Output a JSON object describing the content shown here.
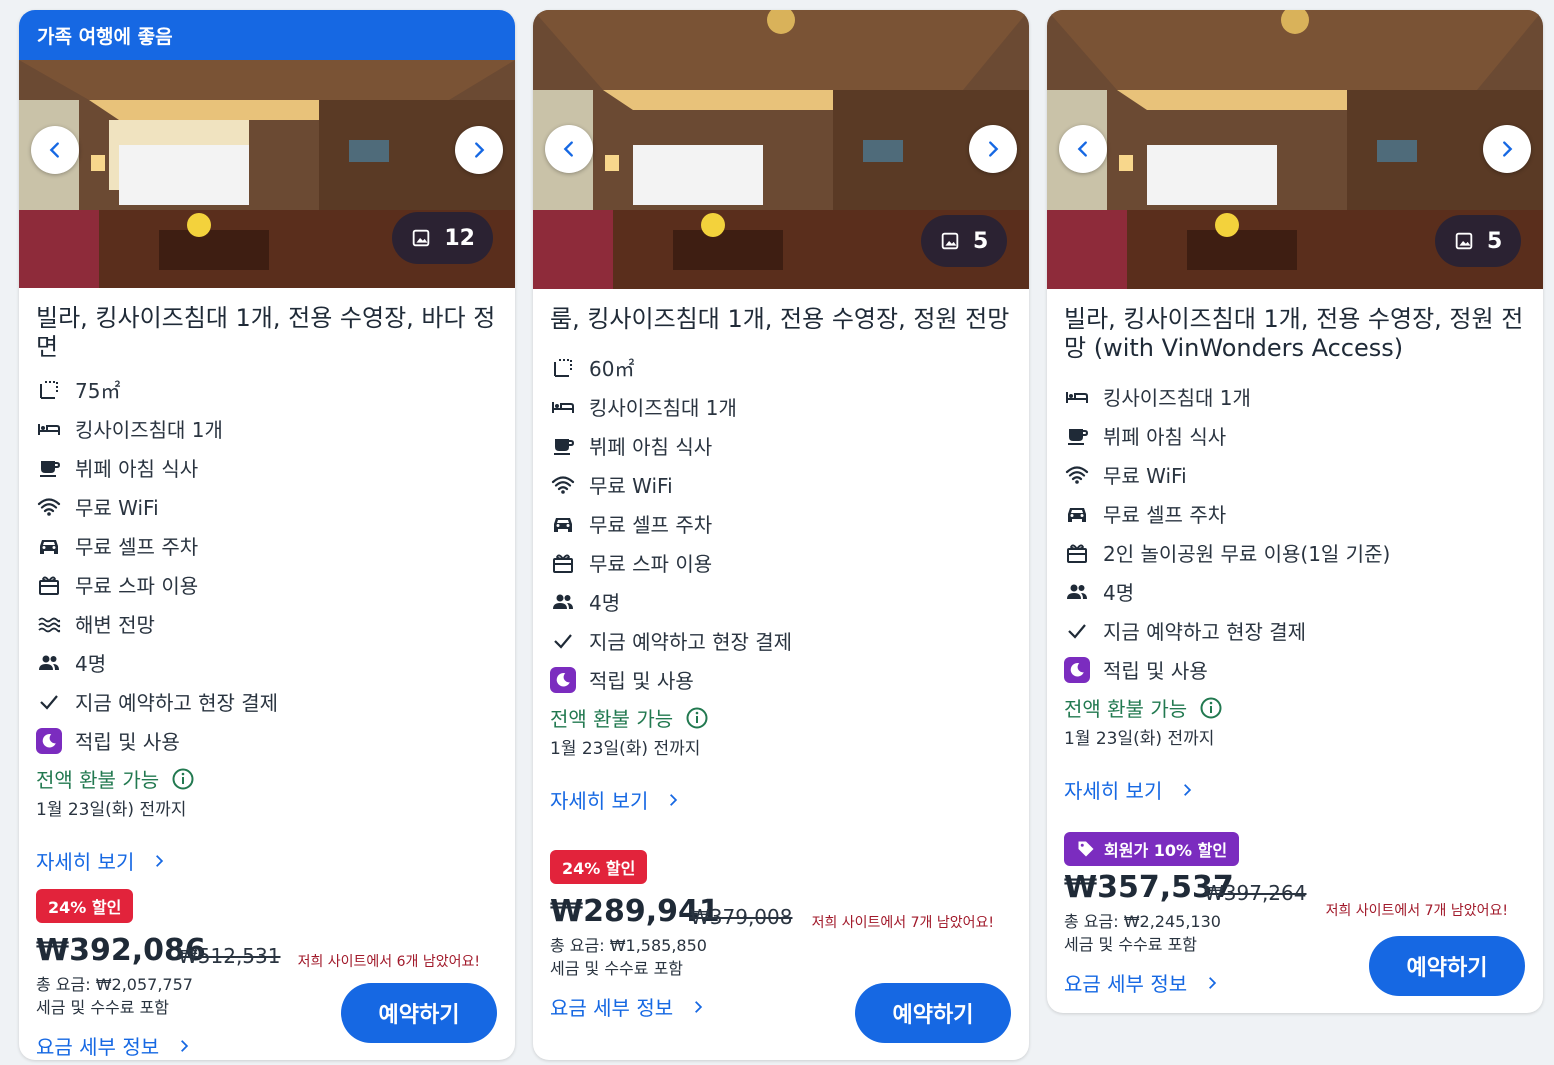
{
  "cards": [
    {
      "banner": "가족 여행에 좋음",
      "photo_count": "12",
      "title": "빌라, 킹사이즈침대 1개, 전용 수영장, 바다 정면",
      "amenities": [
        {
          "icon": "area-icon",
          "label": "75㎡"
        },
        {
          "icon": "bed-icon",
          "label": "킹사이즈침대 1개"
        },
        {
          "icon": "coffee-icon",
          "label": "뷔페 아침 식사"
        },
        {
          "icon": "wifi-icon",
          "label": "무료 WiFi"
        },
        {
          "icon": "car-icon",
          "label": "무료 셀프 주차"
        },
        {
          "icon": "spa-icon",
          "label": "무료 스파 이용"
        },
        {
          "icon": "waves-icon",
          "label": "해변 전망"
        },
        {
          "icon": "people-icon",
          "label": "4명"
        },
        {
          "icon": "check-icon",
          "label": "지금 예약하고 현장 결제"
        },
        {
          "icon": "moon-icon",
          "label": "적립 및 사용"
        }
      ],
      "refund": "전액 환불 가능",
      "refund_date": "1월 23일(화) 전까지",
      "details": "자세히 보기",
      "discount": "24% 할인",
      "price": "₩392,086",
      "original_price": "₩512,531",
      "left_msg": "저희 사이트에서 6개 남았어요!",
      "total": "총 요금: ₩2,057,757",
      "tax_note": "세금 및 수수료 포함",
      "pricing_details": "요금 세부 정보",
      "reserve": "예약하기"
    },
    {
      "photo_count": "5",
      "title": "룸, 킹사이즈침대 1개, 전용 수영장, 정원 전망",
      "amenities": [
        {
          "icon": "area-icon",
          "label": "60㎡"
        },
        {
          "icon": "bed-icon",
          "label": "킹사이즈침대 1개"
        },
        {
          "icon": "coffee-icon",
          "label": "뷔페 아침 식사"
        },
        {
          "icon": "wifi-icon",
          "label": "무료 WiFi"
        },
        {
          "icon": "car-icon",
          "label": "무료 셀프 주차"
        },
        {
          "icon": "spa-icon",
          "label": "무료 스파 이용"
        },
        {
          "icon": "people-icon",
          "label": "4명"
        },
        {
          "icon": "check-icon",
          "label": "지금 예약하고 현장 결제"
        },
        {
          "icon": "moon-icon",
          "label": "적립 및 사용"
        }
      ],
      "refund": "전액 환불 가능",
      "refund_date": "1월 23일(화) 전까지",
      "details": "자세히 보기",
      "discount": "24% 할인",
      "price": "₩289,941",
      "original_price": "₩379,008",
      "left_msg": "저희 사이트에서 7개 남았어요!",
      "total": "총 요금: ₩1,585,850",
      "tax_note": "세금 및 수수료 포함",
      "pricing_details": "요금 세부 정보",
      "reserve": "예약하기"
    },
    {
      "photo_count": "5",
      "title": "빌라, 킹사이즈침대 1개, 전용 수영장, 정원 전망 (with VinWonders Access)",
      "amenities": [
        {
          "icon": "bed-icon",
          "label": "킹사이즈침대 1개"
        },
        {
          "icon": "coffee-icon",
          "label": "뷔페 아침 식사"
        },
        {
          "icon": "wifi-icon",
          "label": "무료 WiFi"
        },
        {
          "icon": "car-icon",
          "label": "무료 셀프 주차"
        },
        {
          "icon": "ticket-icon",
          "label": "2인 놀이공원 무료 이용(1일 기준)"
        },
        {
          "icon": "people-icon",
          "label": "4명"
        },
        {
          "icon": "check-icon",
          "label": "지금 예약하고 현장 결제"
        },
        {
          "icon": "moon-icon",
          "label": "적립 및 사용"
        }
      ],
      "refund": "전액 환불 가능",
      "refund_date": "1월 23일(화) 전까지",
      "details": "자세히 보기",
      "member_discount": "회원가 10% 할인",
      "price": "₩357,537",
      "original_price": "₩397,264",
      "left_msg": "저희 사이트에서 7개 남았어요!",
      "total": "총 요금: ₩2,245,130",
      "tax_note": "세금 및 수수료 포함",
      "pricing_details": "요금 세부 정보",
      "reserve": "예약하기"
    }
  ],
  "colors": {
    "accent": "#1668e3",
    "discount": "#e2233b",
    "member": "#7b2cbf",
    "refund": "#227950",
    "scarcity": "#a1192a"
  }
}
